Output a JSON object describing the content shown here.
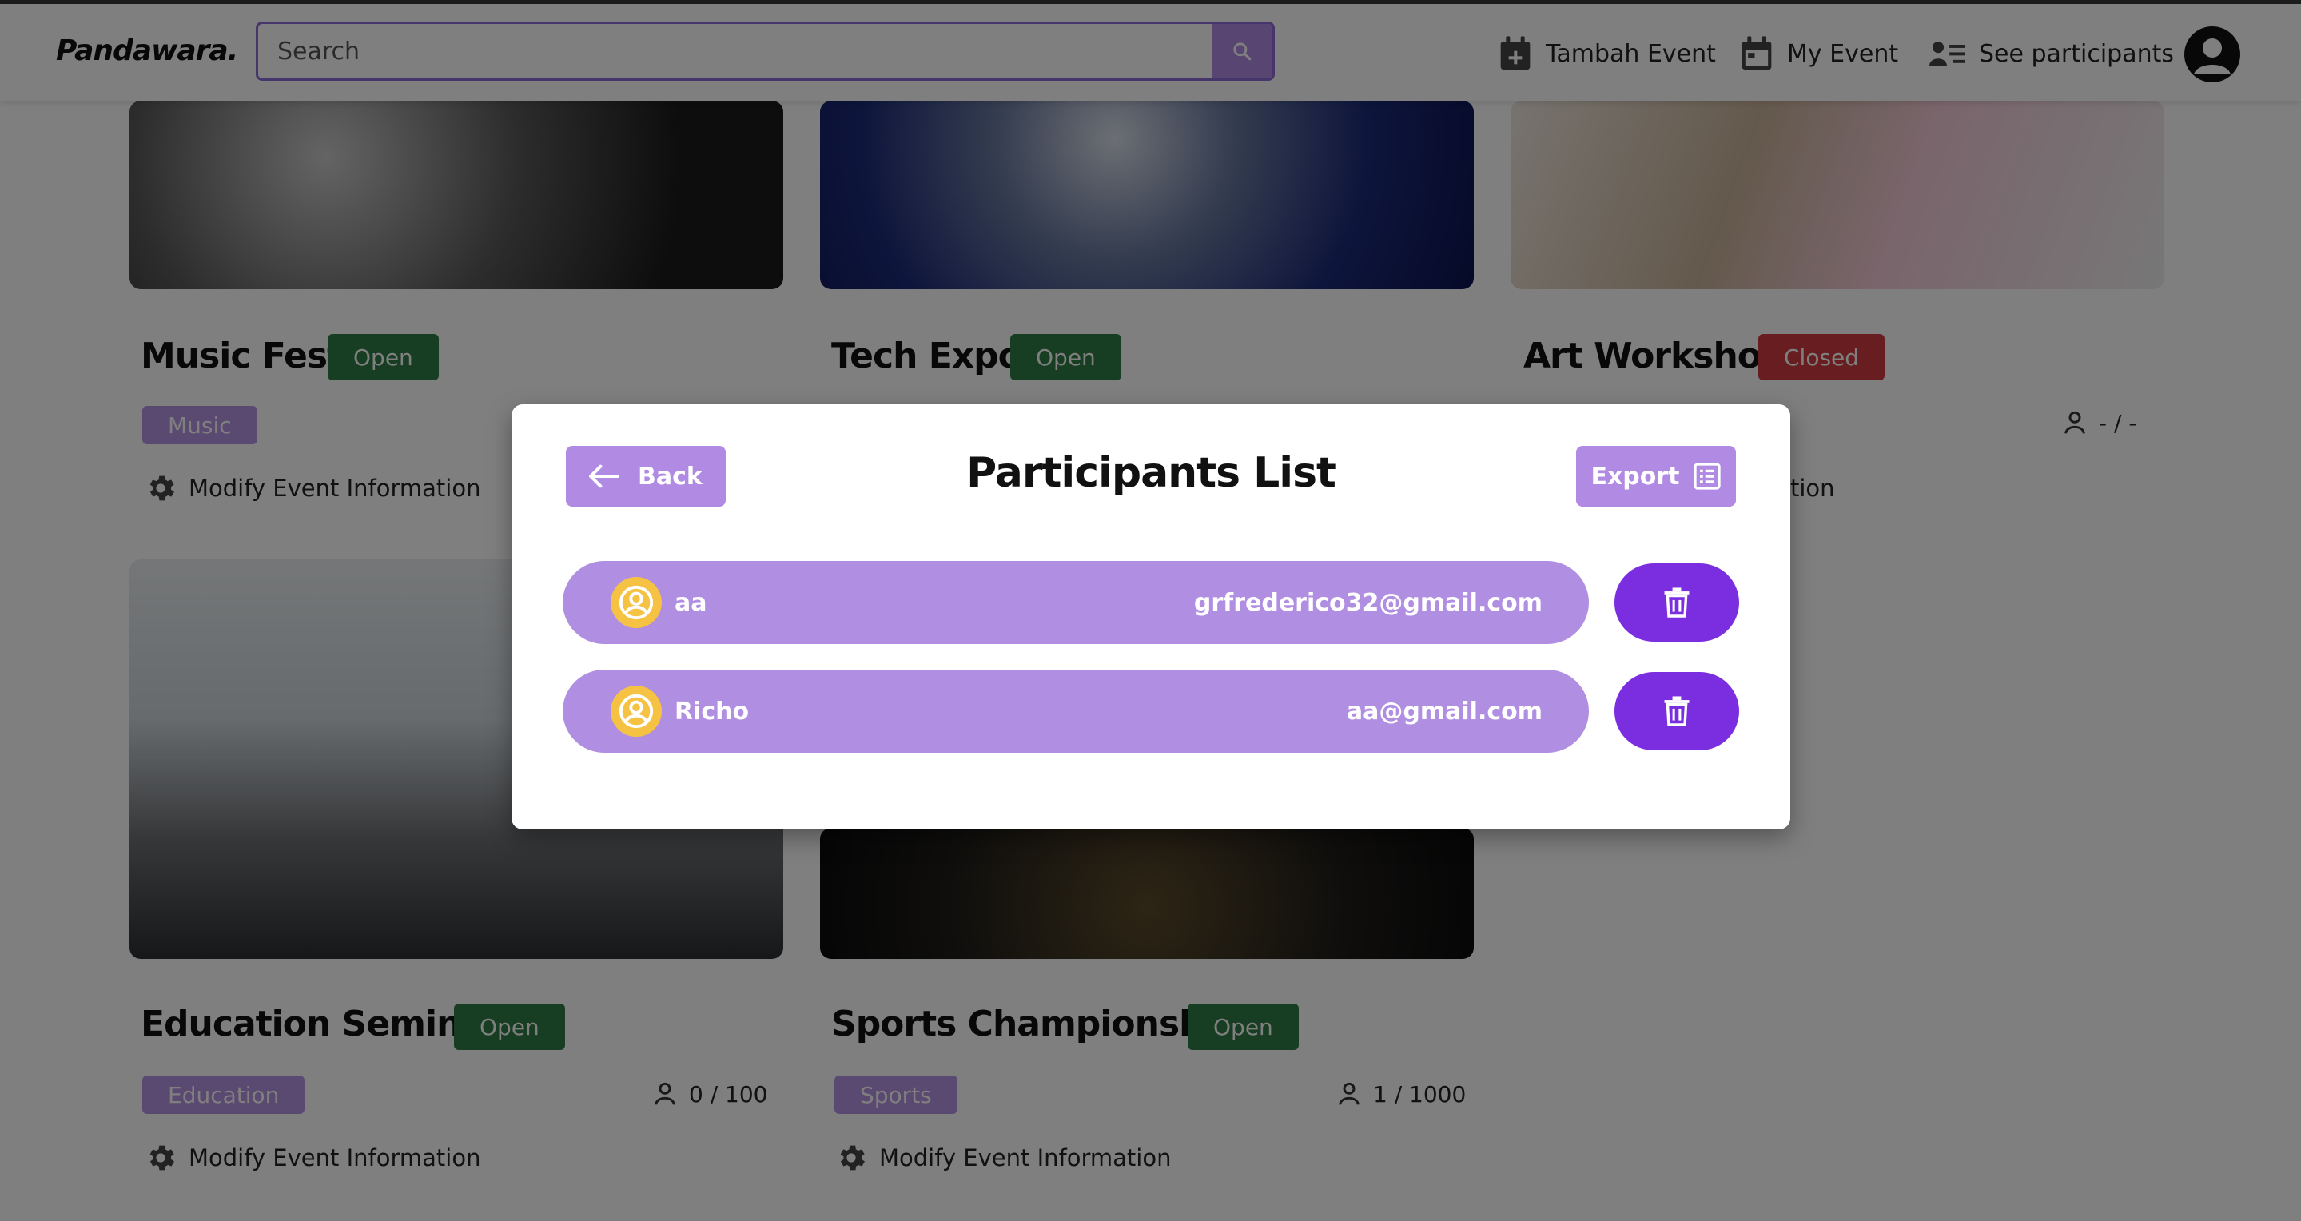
{
  "navbar": {
    "brand": "Pandawara.",
    "search_placeholder": "Search",
    "links": [
      {
        "label": "Tambah Event",
        "icon": "calendar-plus-icon"
      },
      {
        "label": "My Event",
        "icon": "calendar-icon"
      },
      {
        "label": "See participants",
        "icon": "user-list-icon"
      }
    ],
    "avatar_icon": "user-avatar-icon"
  },
  "events": [
    {
      "title": "Music Fest",
      "status": "Open",
      "category": "Music",
      "count": "",
      "modify_label": "Modify Event Information"
    },
    {
      "title": "Tech Expo",
      "status": "Open",
      "category": "",
      "count": "",
      "modify_label": ""
    },
    {
      "title": "Art Workshop",
      "status": "Closed",
      "category": "",
      "count": "- / -",
      "modify_label": "tion"
    },
    {
      "title": "Education Seminar",
      "status": "Open",
      "category": "Education",
      "count": "0 / 100",
      "modify_label": "Modify Event Information"
    },
    {
      "title": "Sports Championship",
      "status": "Open",
      "category": "Sports",
      "count": "1 / 1000",
      "modify_label": "Modify Event Information"
    }
  ],
  "modal": {
    "title": "Participants List",
    "back_label": "Back",
    "export_label": "Export",
    "participants": [
      {
        "name": "aa",
        "email": "grfrederico32@gmail.com"
      },
      {
        "name": "Richo",
        "email": "aa@gmail.com"
      }
    ]
  },
  "colors": {
    "accent": "#b18be3",
    "delete": "#7b2ee0",
    "open": "#2e7d44",
    "closed": "#d13a43",
    "avatar": "#f6c244"
  }
}
